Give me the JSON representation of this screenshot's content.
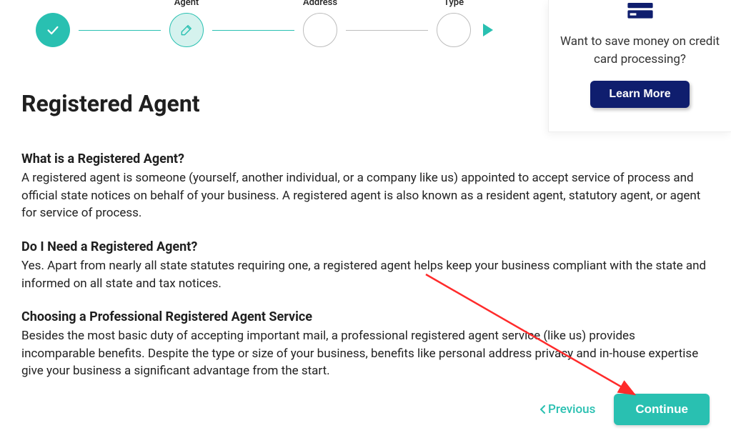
{
  "stepper": {
    "steps": [
      {
        "label": ""
      },
      {
        "label": "Agent"
      },
      {
        "label": "Address"
      },
      {
        "label": "Type"
      }
    ]
  },
  "promo": {
    "text": "Want to save money on credit card processing?",
    "button": "Learn More"
  },
  "page": {
    "title": "Registered Agent",
    "sections": [
      {
        "heading": "What is a Registered Agent?",
        "body": "A registered agent is someone (yourself, another individual, or a company like us) appointed to accept service of process and official state notices on behalf of your business. A registered agent is also known as a resident agent, statutory agent, or agent for service of process."
      },
      {
        "heading": "Do I Need a Registered Agent?",
        "body": "Yes. Apart from nearly all state statutes requiring one, a registered agent helps keep your business compliant with the state and informed on all state and tax notices."
      },
      {
        "heading": "Choosing a Professional Registered Agent Service",
        "body": "Besides the most basic duty of accepting important mail, a professional registered agent service (like us) provides incomparable benefits. Despite the type or size of your business, benefits like personal address privacy and in-house expertise give your business a significant advantage from the start."
      }
    ]
  },
  "nav": {
    "previous": "Previous",
    "continue": "Continue"
  }
}
